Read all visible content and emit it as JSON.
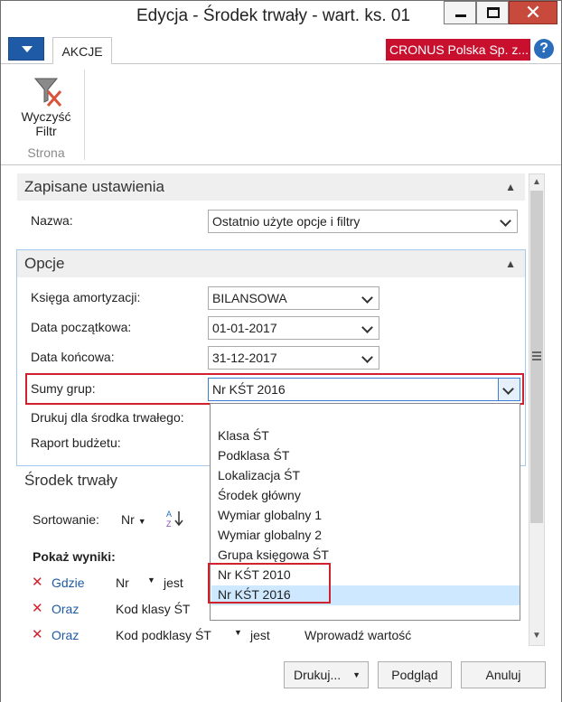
{
  "window": {
    "title": "Edycja - Środek trwały - wart. ks. 01",
    "minimize": "minimize",
    "maximize": "maximize",
    "close": "✕"
  },
  "ribbon": {
    "tab_label": "AKCJE",
    "company": "CRONUS Polska Sp. z...",
    "help": "?",
    "clear_filter_line1": "Wyczyść",
    "clear_filter_line2": "Filtr",
    "group_label": "Strona"
  },
  "saved_settings": {
    "header": "Zapisane ustawienia",
    "name_label": "Nazwa:",
    "name_value": "Ostatnio użyte opcje i filtry"
  },
  "options": {
    "header": "Opcje",
    "ledger_label": "Księga amortyzacji:",
    "ledger_value": "BILANSOWA",
    "start_label": "Data początkowa:",
    "start_value": "01-01-2017",
    "end_label": "Data końcowa:",
    "end_value": "31-12-2017",
    "group_totals_label": "Sumy grup:",
    "group_totals_value": "Nr KŚT 2016",
    "print_label": "Drukuj dla środka trwałego:",
    "budget_label": "Raport budżetu:"
  },
  "dropdown": {
    "items": [
      "Klasa ŚT",
      "Podklasa ŚT",
      "Lokalizacja ŚT",
      "Środek główny",
      "Wymiar globalny 1",
      "Wymiar globalny 2",
      "Grupa księgowa ŚT",
      "Nr KŚT 2010",
      "Nr KŚT 2016"
    ],
    "selected_index": 8
  },
  "fixed_asset": {
    "header": "Środek trwały",
    "sort_label": "Sortowanie:",
    "sort_value": "Nr",
    "show_results": "Pokaż wyniki:",
    "filters": [
      {
        "connector": "Gdzie",
        "field": "Nr",
        "op": "jest"
      },
      {
        "connector": "Oraz",
        "field": "Kod klasy ŚT"
      },
      {
        "connector": "Oraz",
        "field": "Kod podklasy ŚT",
        "op": "jest",
        "value": "Wprowadź wartość"
      }
    ]
  },
  "buttons": {
    "print": "Drukuj...",
    "preview": "Podgląd",
    "cancel": "Anuluj"
  },
  "colors": {
    "accent_red": "#d0212e",
    "company_red": "#c8102e",
    "menu_blue": "#1f5aa6",
    "link_blue": "#1f5aa6",
    "selected_bg": "#cde8ff"
  }
}
